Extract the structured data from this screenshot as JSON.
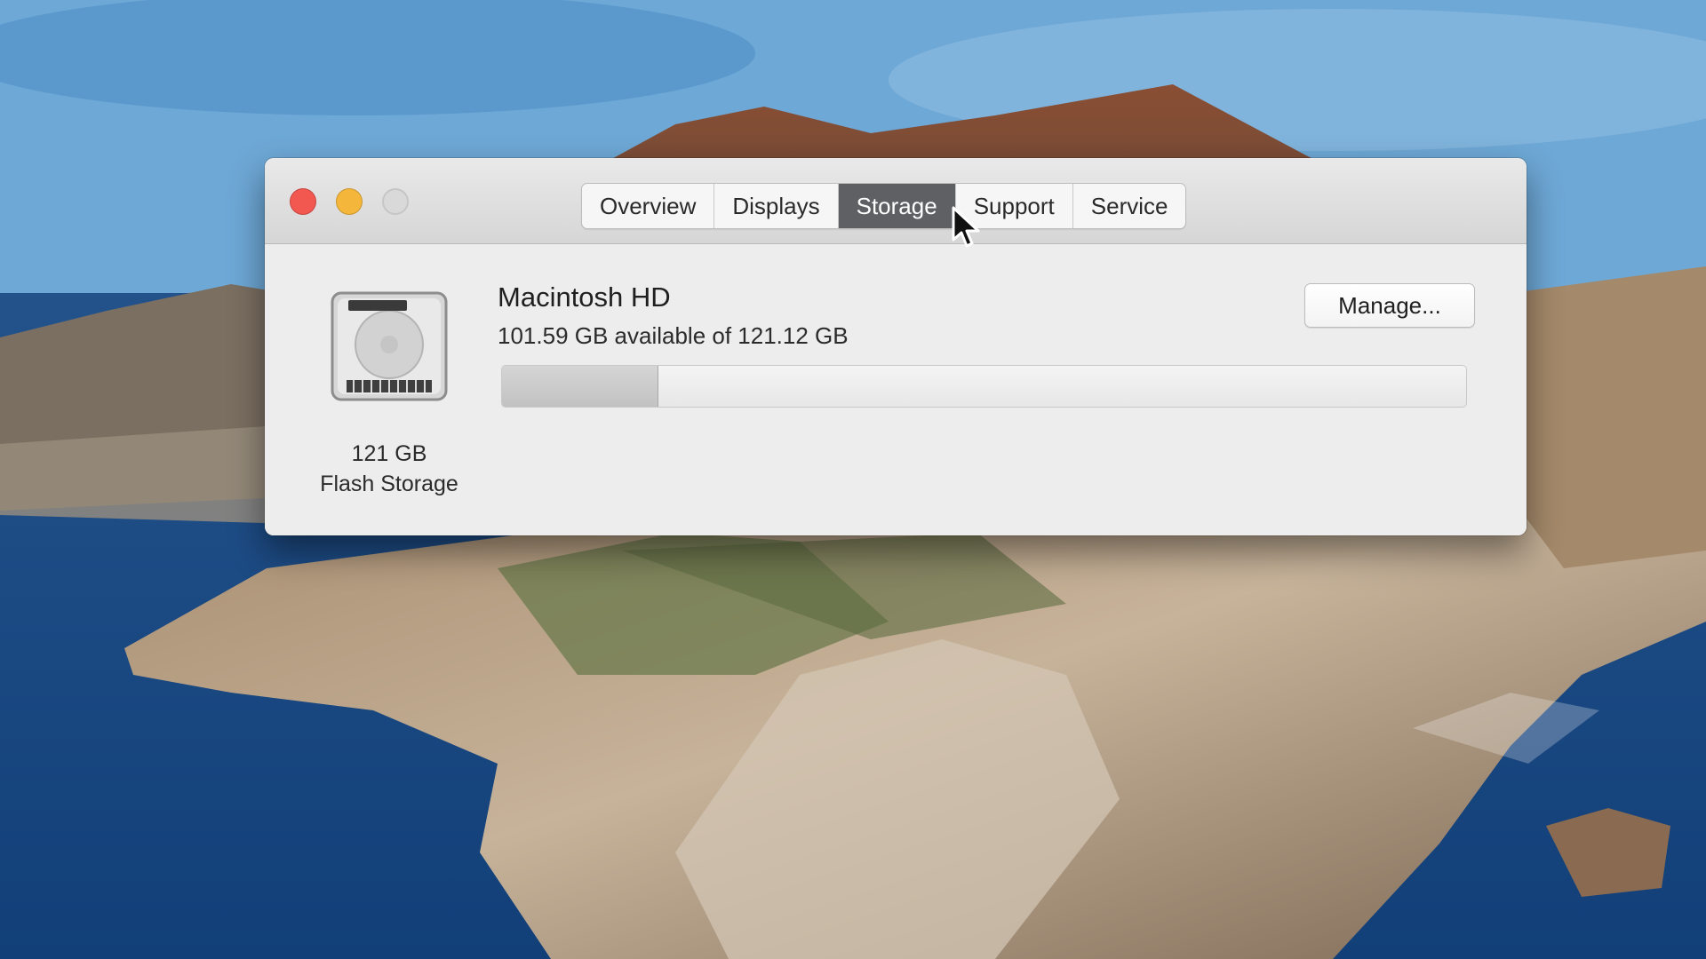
{
  "window": {
    "tabs": [
      {
        "label": "Overview",
        "active": false
      },
      {
        "label": "Displays",
        "active": false
      },
      {
        "label": "Storage",
        "active": true
      },
      {
        "label": "Support",
        "active": false
      },
      {
        "label": "Service",
        "active": false
      }
    ],
    "traffic_lights": [
      "close",
      "minimize",
      "zoom"
    ]
  },
  "storage": {
    "drive_icon": "hard-drive-icon",
    "drive_size": "121 GB",
    "drive_type": "Flash Storage",
    "volume_name": "Macintosh HD",
    "available_text": "101.59 GB available of 121.12 GB",
    "used_fraction": 0.161,
    "manage_button": "Manage..."
  },
  "colors": {
    "close": "#f25750",
    "minimize": "#f5b73b",
    "zoom": "#d9d9d9",
    "active_tab": "#5f6063"
  }
}
